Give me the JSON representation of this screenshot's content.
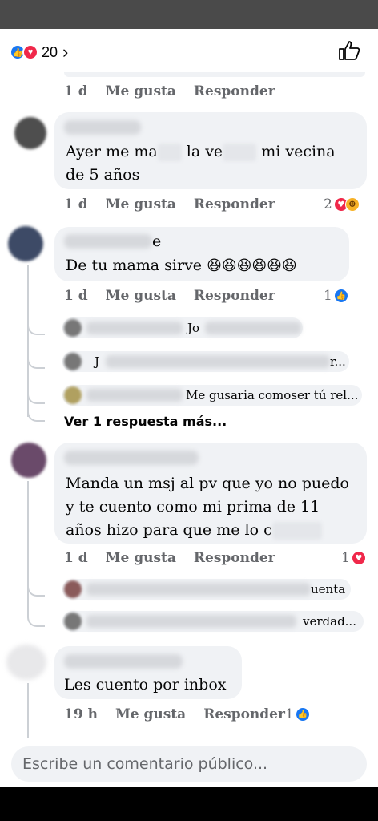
{
  "top": {
    "reaction_count": "20",
    "chevron": "›"
  },
  "comments": [
    {
      "meta": {
        "time": "1 d",
        "like": "Me gusta",
        "reply": "Responder"
      }
    },
    {
      "text_parts": [
        "Ayer me ma",
        "la ve",
        "mi vecina",
        "de 5 años"
      ],
      "meta": {
        "time": "1 d",
        "like": "Me gusta",
        "reply": "Responder"
      },
      "reactions": {
        "count": "2",
        "icons": [
          "love-icon",
          "haha-icon"
        ]
      }
    },
    {
      "name_tail": "e",
      "text": "De tu mama sirve",
      "emoji": "😆😆😆😆😆😆",
      "meta": {
        "time": "1 d",
        "like": "Me gusta",
        "reply": "Responder"
      },
      "reactions": {
        "count": "1",
        "icons": [
          "like-icon"
        ]
      },
      "replies": [
        {
          "text": "Jo"
        },
        {
          "prefix": "J",
          "suffix": "r..."
        },
        {
          "text": "Me gusaria comoser tú rel..."
        }
      ],
      "more": "Ver 1 respuesta más..."
    },
    {
      "lines": [
        "Manda un msj al pv que yo no puedo",
        "y te cuento como mi prima de 11",
        "años hizo para que me lo c"
      ],
      "meta": {
        "time": "1 d",
        "like": "Me gusta",
        "reply": "Responder"
      },
      "reactions": {
        "count": "1",
        "icons": [
          "love-icon"
        ]
      },
      "replies": [
        {
          "text": "uenta"
        },
        {
          "text": "verdad..."
        }
      ]
    },
    {
      "text": "Les cuento por inbox",
      "meta": {
        "time": "19 h",
        "like": "Me gusta",
        "reply": "Responder"
      },
      "reactions": {
        "count": "1",
        "icons": [
          "like-icon"
        ]
      }
    }
  ],
  "input": {
    "placeholder": "Escribe un comentario público..."
  },
  "colors": {
    "like": "#1877f2",
    "love": "#f0284a",
    "haha": "#f7b125",
    "meta": "#65676b",
    "bubble": "#f0f2f5"
  }
}
